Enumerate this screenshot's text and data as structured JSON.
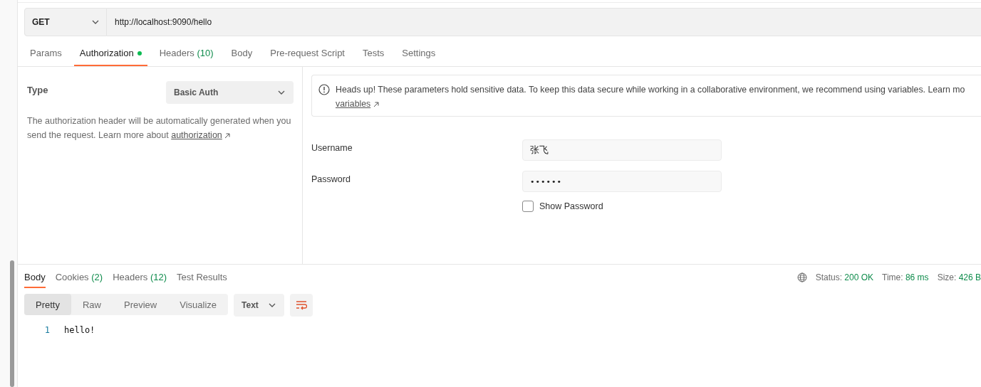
{
  "request": {
    "method": "GET",
    "url": "http://localhost:9090/hello"
  },
  "request_tabs": [
    {
      "label": "Params",
      "selected": false
    },
    {
      "label": "Authorization",
      "dot": true,
      "selected": true
    },
    {
      "label": "Headers",
      "count": "(10)",
      "selected": false
    },
    {
      "label": "Body",
      "selected": false
    },
    {
      "label": "Pre-request Script",
      "selected": false
    },
    {
      "label": "Tests",
      "selected": false
    },
    {
      "label": "Settings",
      "selected": false
    }
  ],
  "auth": {
    "type_label": "Type",
    "type_value": "Basic Auth",
    "description": "The authorization header will be automatically generated when you send the request. Learn more about",
    "description_link": "authorization",
    "alert": "Heads up! These parameters hold sensitive data. To keep this data secure while working in a collaborative environment, we recommend using variables. Learn mo",
    "alert_link": "variables",
    "fields": [
      {
        "label": "Username",
        "value": "张飞"
      },
      {
        "label": "Password",
        "value": "••••••"
      }
    ],
    "show_password": {
      "label": "Show Password",
      "checked": false
    }
  },
  "response_tabs": [
    {
      "label": "Body",
      "selected": true
    },
    {
      "label": "Cookies",
      "count": "(2)",
      "selected": false
    },
    {
      "label": "Headers",
      "count": "(12)",
      "selected": false
    },
    {
      "label": "Test Results",
      "selected": false
    }
  ],
  "status": [
    {
      "label": "Status:",
      "value": "200 OK"
    },
    {
      "label": "Time:",
      "value": "86 ms"
    },
    {
      "label": "Size:",
      "value": "426 B"
    }
  ],
  "formats": [
    {
      "label": "Pretty",
      "selected": true
    },
    {
      "label": "Raw",
      "selected": false
    },
    {
      "label": "Preview",
      "selected": false
    },
    {
      "label": "Visualize",
      "selected": false
    }
  ],
  "language": "Text",
  "code": [
    {
      "number": "1",
      "text": "hello!"
    }
  ]
}
